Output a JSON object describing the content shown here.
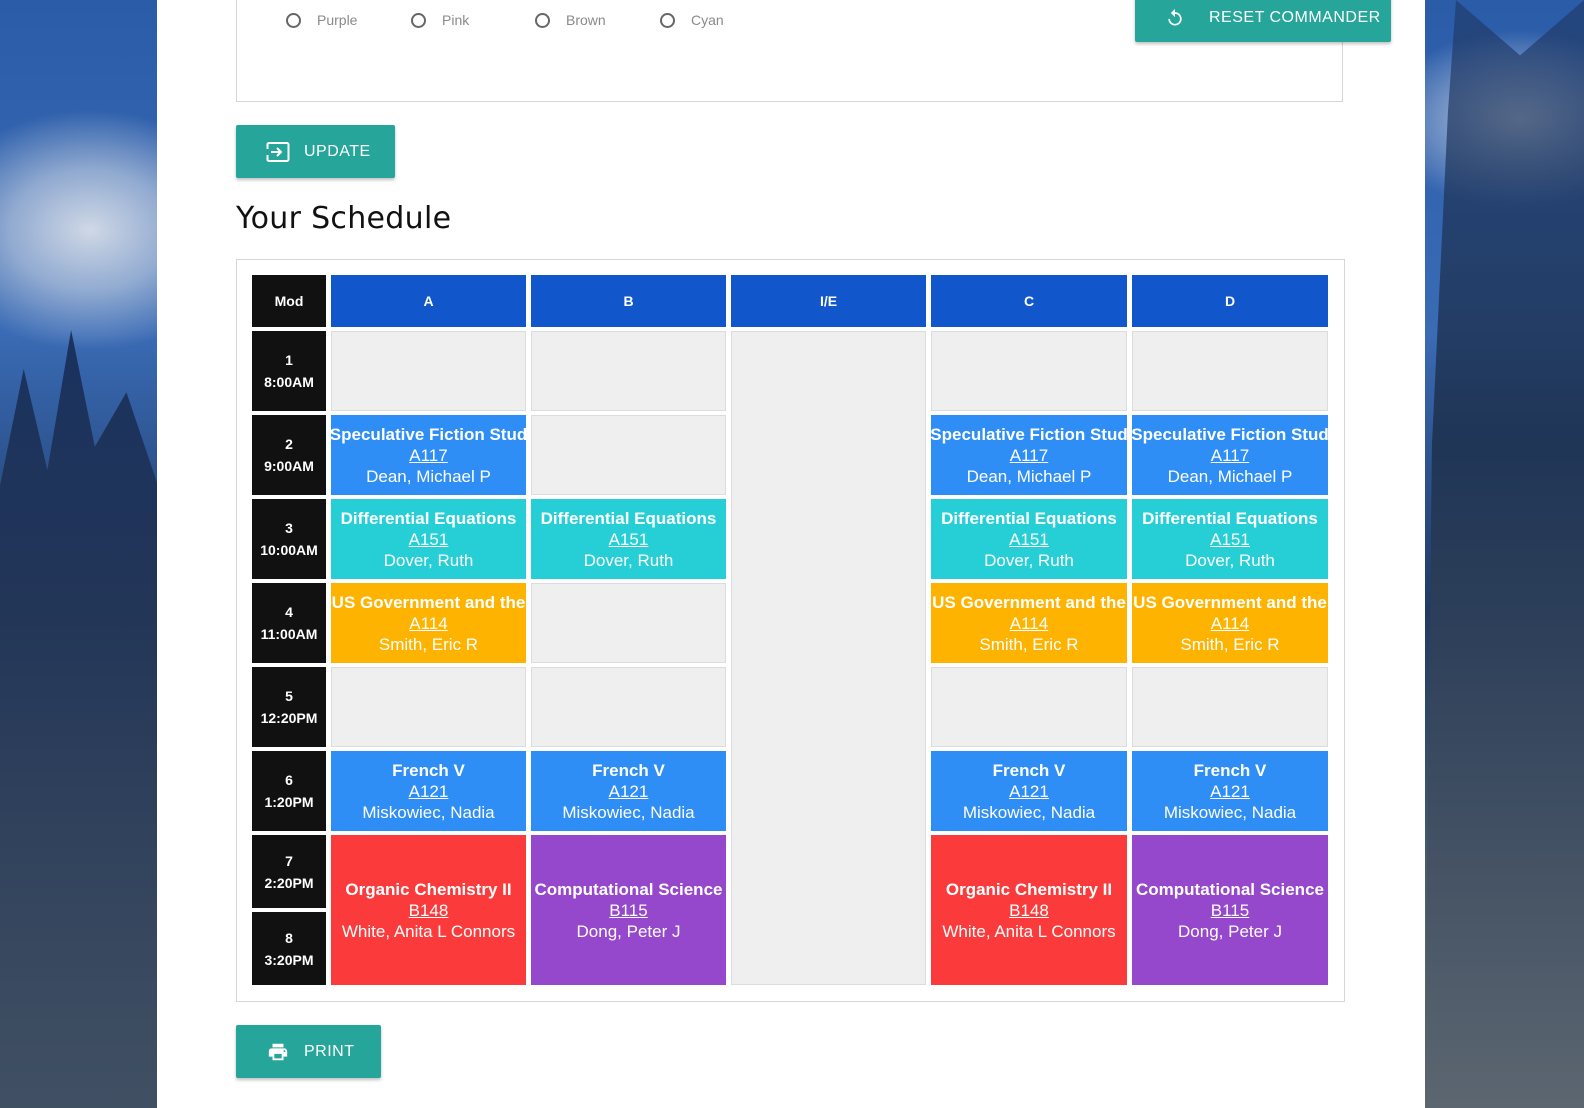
{
  "colors": {
    "accent": "#26a69a",
    "header": "#1256cc",
    "mod": "#111111",
    "empty": "#efefef",
    "blue": "#2f8ef6",
    "cyan": "#26cfd6",
    "amber": "#fdb300",
    "red": "#fb3b3b",
    "purple": "#9648cd"
  },
  "color_options": [
    {
      "label": "Purple",
      "selected": false
    },
    {
      "label": "Pink",
      "selected": false
    },
    {
      "label": "Brown",
      "selected": false
    },
    {
      "label": "Cyan",
      "selected": false
    }
  ],
  "buttons": {
    "reset": {
      "label": "RESET COMMANDER",
      "icon": "reset-icon"
    },
    "update": {
      "label": "UPDATE",
      "icon": "input-icon"
    },
    "print": {
      "label": "PRINT",
      "icon": "printer-icon"
    }
  },
  "schedule": {
    "title": "Your Schedule",
    "mod_header": "Mod",
    "days": [
      "A",
      "B",
      "I/E",
      "C",
      "D"
    ],
    "mods": [
      {
        "num": "1",
        "time": "8:00AM"
      },
      {
        "num": "2",
        "time": "9:00AM"
      },
      {
        "num": "3",
        "time": "10:00AM"
      },
      {
        "num": "4",
        "time": "11:00AM"
      },
      {
        "num": "5",
        "time": "12:20PM"
      },
      {
        "num": "6",
        "time": "1:20PM"
      },
      {
        "num": "7",
        "time": "2:20PM"
      },
      {
        "num": "8",
        "time": "3:20PM"
      }
    ],
    "courses": {
      "spec": {
        "name": "Speculative Fiction Stud",
        "room": "A117",
        "teacher": "Dean, Michael P",
        "color": "blue"
      },
      "diffeq": {
        "name": "Differential Equations",
        "room": "A151",
        "teacher": "Dover, Ruth",
        "color": "cyan"
      },
      "usgov": {
        "name": "US Government and the",
        "room": "A114",
        "teacher": "Smith, Eric R",
        "color": "amber"
      },
      "french": {
        "name": "French V",
        "room": "A121",
        "teacher": "Miskowiec, Nadia",
        "color": "blue"
      },
      "orgchem": {
        "name": "Organic Chemistry II",
        "room": "B148",
        "teacher": "White, Anita L Connors",
        "color": "red"
      },
      "compsci": {
        "name": "Computational Science",
        "room": "B115",
        "teacher": "Dong, Peter J",
        "color": "purple"
      }
    },
    "grid": [
      [
        null,
        "spec",
        "diffeq",
        "usgov",
        null,
        "french",
        "orgchem",
        "orgchem"
      ],
      [
        null,
        null,
        "diffeq",
        null,
        null,
        "french",
        "compsci",
        "compsci"
      ],
      [
        null,
        null,
        null,
        null,
        null,
        null,
        null,
        null
      ],
      [
        null,
        "spec",
        "diffeq",
        "usgov",
        null,
        "french",
        "orgchem",
        "orgchem"
      ],
      [
        null,
        "spec",
        "diffeq",
        "usgov",
        null,
        "french",
        "compsci",
        "compsci"
      ]
    ]
  }
}
